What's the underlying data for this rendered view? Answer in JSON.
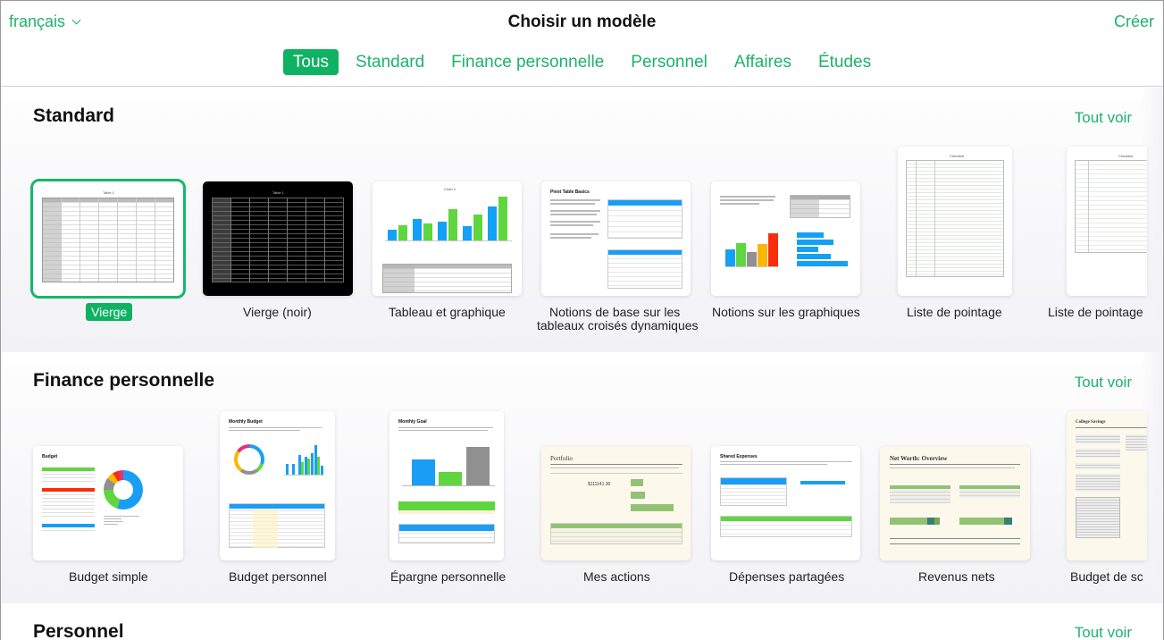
{
  "header": {
    "language": "français",
    "title": "Choisir un modèle",
    "create_label": "Créer",
    "tabs": [
      {
        "label": "Tous",
        "active": true
      },
      {
        "label": "Standard",
        "active": false
      },
      {
        "label": "Finance personnelle",
        "active": false
      },
      {
        "label": "Personnel",
        "active": false
      },
      {
        "label": "Affaires",
        "active": false
      },
      {
        "label": "Études",
        "active": false
      }
    ]
  },
  "accent_color": "#1db36b",
  "sections": [
    {
      "title": "Standard",
      "see_all": "Tout voir",
      "templates": [
        {
          "label": "Vierge",
          "selected": true,
          "thumb_title": "Table 1"
        },
        {
          "label": "Vierge (noir)",
          "selected": false,
          "thumb_title": "Table 1"
        },
        {
          "label": "Tableau et graphique",
          "selected": false,
          "thumb_title": "Chart 1"
        },
        {
          "label_line1": "Notions de base sur les",
          "label_line2": "tableaux croisés dynamiques",
          "selected": false,
          "thumb_title": "Pivot Table Basics"
        },
        {
          "label": "Notions sur les graphiques",
          "selected": false
        },
        {
          "label": "Liste de pointage",
          "selected": false,
          "thumb_title": "Checklist"
        },
        {
          "label": "Liste de pointage",
          "selected": false,
          "thumb_title": "Checklist"
        }
      ]
    },
    {
      "title": "Finance personnelle",
      "see_all": "Tout voir",
      "templates": [
        {
          "label": "Budget simple",
          "thumb_title": "Budget"
        },
        {
          "label": "Budget personnel",
          "thumb_title": "Monthly Budget"
        },
        {
          "label": "Épargne personnelle",
          "thumb_title": "Monthly Goal"
        },
        {
          "label": "Mes actions",
          "thumb_title": "Portfolio",
          "thumb_value": "$111141.30"
        },
        {
          "label": "Dépenses partagées",
          "thumb_title": "Shared Expenses"
        },
        {
          "label": "Revenus nets",
          "thumb_title": "Net Worth: Overview"
        },
        {
          "label": "Budget de sc",
          "thumb_title": "College Savings"
        }
      ]
    },
    {
      "title": "Personnel",
      "see_all": "Tout voir"
    }
  ]
}
